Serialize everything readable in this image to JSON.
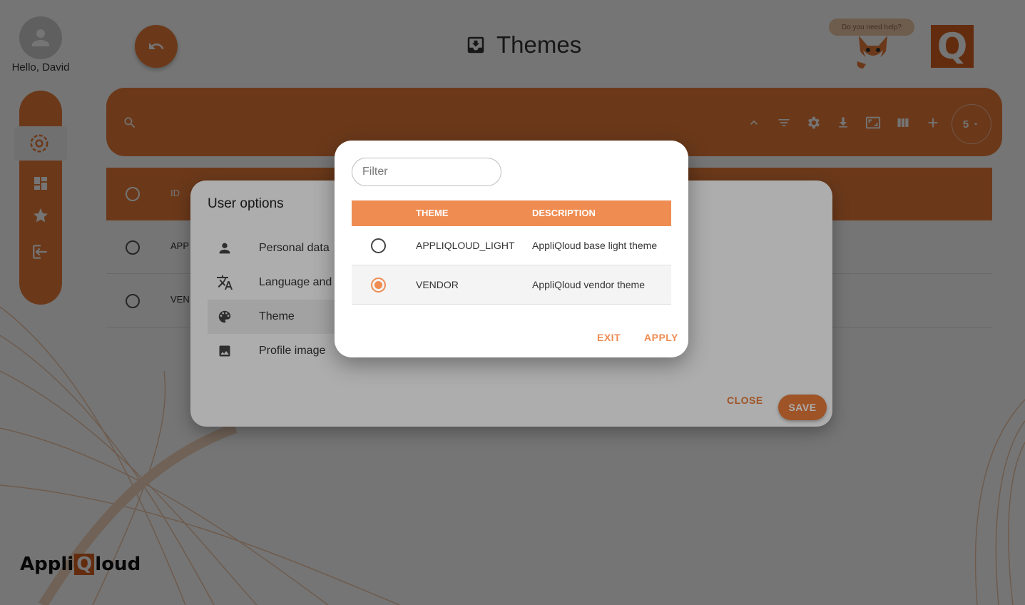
{
  "header": {
    "greeting": "Hello, David",
    "page_title": "Themes",
    "help_text": "Do you need help?",
    "brand_letter": "Q"
  },
  "toolbar": {
    "rows_per_page": "5"
  },
  "table": {
    "header_id": "ID",
    "rows": [
      {
        "id": "APP"
      },
      {
        "id": "VEN"
      }
    ]
  },
  "footer": {
    "logo_prefix": "Appli",
    "logo_q": "Q",
    "logo_suffix": "loud"
  },
  "user_options": {
    "title": "User options",
    "items": [
      {
        "label": "Personal data",
        "icon": "person-icon"
      },
      {
        "label": "Language and",
        "icon": "translate-icon"
      },
      {
        "label": "Theme",
        "icon": "palette-icon"
      },
      {
        "label": "Profile image",
        "icon": "image-icon"
      }
    ],
    "close_label": "CLOSE",
    "save_label": "SAVE"
  },
  "theme_dialog": {
    "filter_placeholder": "Filter",
    "columns": [
      "THEME",
      "DESCRIPTION"
    ],
    "rows": [
      {
        "theme": "APPLIQLOUD_LIGHT",
        "description": "AppliQloud base light theme",
        "selected": false
      },
      {
        "theme": "VENDOR",
        "description": "AppliQloud vendor theme",
        "selected": true
      }
    ],
    "exit_label": "EXIT",
    "apply_label": "APPLY"
  },
  "colors": {
    "accent": "#e97c3a",
    "accent_light": "#ef8c52",
    "brand": "#d9621f"
  }
}
